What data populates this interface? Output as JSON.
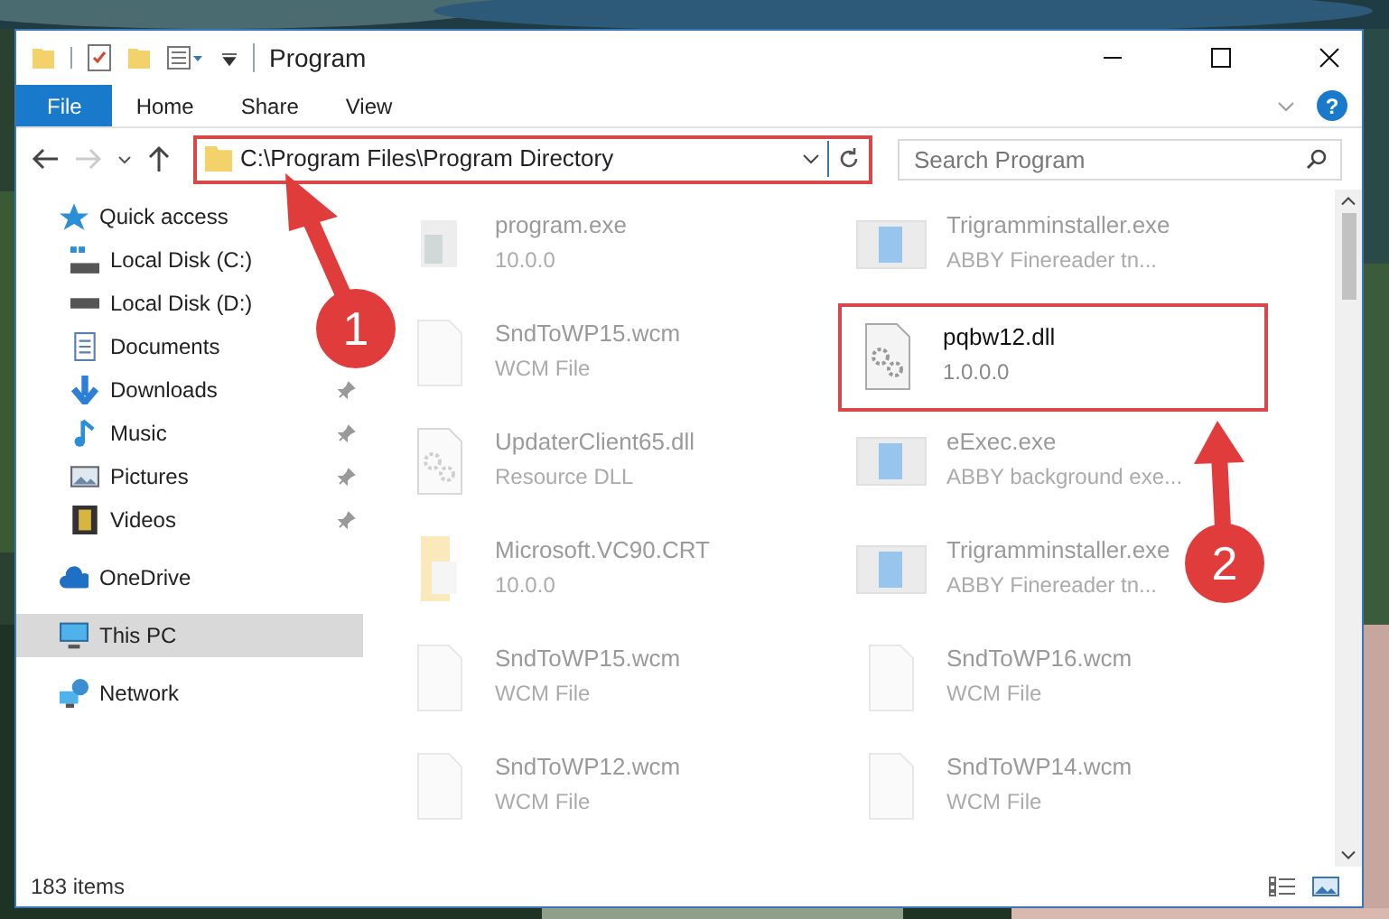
{
  "window": {
    "title": "Program"
  },
  "ribbon": {
    "tabs": [
      {
        "label": "File",
        "selected": true
      },
      {
        "label": "Home",
        "selected": false
      },
      {
        "label": "Share",
        "selected": false
      },
      {
        "label": "View",
        "selected": false
      }
    ],
    "help": "?"
  },
  "address_bar": {
    "path": "C:\\Program Files\\Program Directory",
    "highlighted": true
  },
  "search": {
    "placeholder": "Search Program"
  },
  "sidebar": {
    "items": [
      {
        "label": "Quick access",
        "kind": "star",
        "selected": false,
        "children": [
          {
            "label": "Local Disk (C:)",
            "kind": "disk-c",
            "pinned": false,
            "selected": false
          },
          {
            "label": "Local Disk (D:)",
            "kind": "disk",
            "pinned": false,
            "selected": false
          },
          {
            "label": "Documents",
            "kind": "doc",
            "pinned": false,
            "selected": false
          },
          {
            "label": "Downloads",
            "kind": "download",
            "pinned": true,
            "selected": false
          },
          {
            "label": "Music",
            "kind": "music",
            "pinned": true,
            "selected": false
          },
          {
            "label": "Pictures",
            "kind": "pictures",
            "pinned": true,
            "selected": false
          },
          {
            "label": "Videos",
            "kind": "video",
            "pinned": true,
            "selected": false
          }
        ]
      },
      {
        "label": "OneDrive",
        "kind": "cloud",
        "selected": false
      },
      {
        "label": "This PC",
        "kind": "pc",
        "selected": true
      },
      {
        "label": "Network",
        "kind": "network",
        "selected": false
      }
    ]
  },
  "files": [
    {
      "name": "program.exe",
      "detail": "10.0.0",
      "kind": "exe",
      "highlighted": false
    },
    {
      "name": "Trigramminstaller.exe",
      "detail": "ABBY Finereader tn...",
      "kind": "app",
      "highlighted": false
    },
    {
      "name": "SndToWP15.wcm",
      "detail": "WCM File",
      "kind": "file",
      "highlighted": false
    },
    {
      "name": "pqbw12.dll",
      "detail": "1.0.0.0",
      "kind": "dll",
      "highlighted": true
    },
    {
      "name": "UpdaterClient65.dll",
      "detail": "Resource DLL",
      "kind": "dll",
      "highlighted": false
    },
    {
      "name": "eExec.exe",
      "detail": "ABBY background exe...",
      "kind": "app",
      "highlighted": false
    },
    {
      "name": "Microsoft.VC90.CRT",
      "detail": "10.0.0",
      "kind": "folder",
      "highlighted": false
    },
    {
      "name": "Trigramminstaller.exe",
      "detail": "ABBY Finereader tn...",
      "kind": "app",
      "highlighted": false
    },
    {
      "name": "SndToWP15.wcm",
      "detail": "WCM File",
      "kind": "file",
      "highlighted": false
    },
    {
      "name": "SndToWP16.wcm",
      "detail": "WCM File",
      "kind": "file",
      "highlighted": false
    },
    {
      "name": "SndToWP12.wcm",
      "detail": "WCM File",
      "kind": "file",
      "highlighted": false
    },
    {
      "name": "SndToWP14.wcm",
      "detail": "WCM File",
      "kind": "file",
      "highlighted": false
    }
  ],
  "status_bar": {
    "text": "183 items"
  },
  "annotations": [
    {
      "number": "1"
    },
    {
      "number": "2"
    }
  ]
}
